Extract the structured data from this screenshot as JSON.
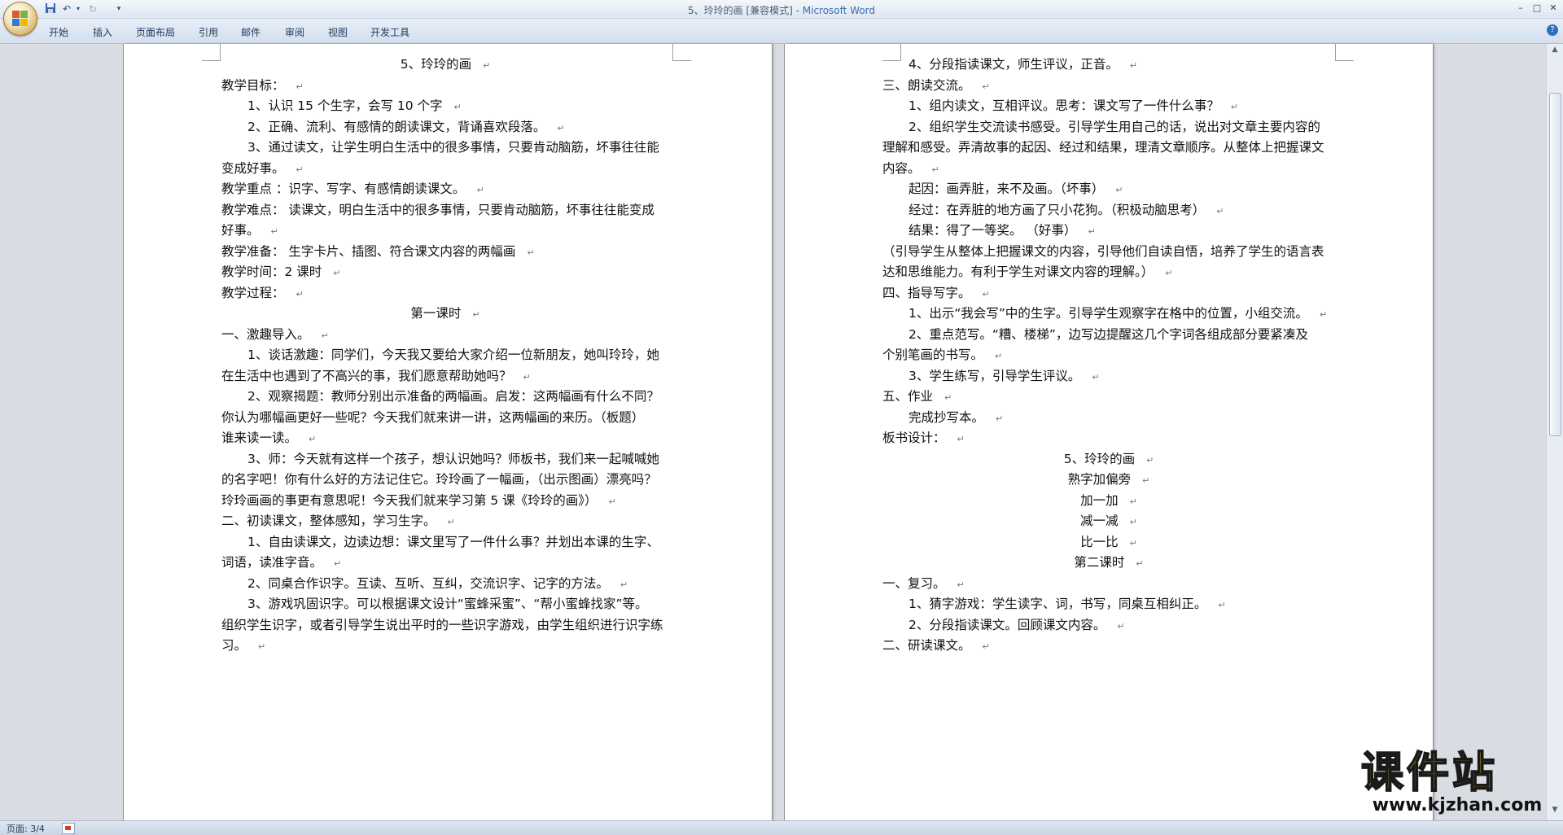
{
  "window": {
    "title_doc": "5、玲玲的画 [兼容模式] - ",
    "title_app": "Microsoft Word"
  },
  "quick_access": {
    "save_icon": "save-icon",
    "undo_icon": "undo-icon",
    "redo_icon": "redo-icon",
    "customize_icon": "dropdown-icon"
  },
  "ribbon": {
    "tabs": [
      "开始",
      "插入",
      "页面布局",
      "引用",
      "邮件",
      "审阅",
      "视图",
      "开发工具"
    ]
  },
  "document": {
    "left_page": [
      {
        "text": "5、玲玲的画",
        "align": "center"
      },
      {
        "text": "教学目标："
      },
      {
        "text": "1、认识 15 个生字，会写 10 个字",
        "indent": true
      },
      {
        "text": "2、正确、流利、有感情的朗读课文，背诵喜欢段落。",
        "indent": true
      },
      {
        "text": "3、通过读文，让学生明白生活中的很多事情，只要肯动脑筋，坏事往往能",
        "indent": true,
        "nomark": true
      },
      {
        "text": "变成好事。"
      },
      {
        "text": "教学重点 ：识字、写字、有感情朗读课文。"
      },
      {
        "text": "教学难点： 读课文，明白生活中的很多事情，只要肯动脑筋，坏事往往能变成",
        "nomark": true
      },
      {
        "text": "好事。"
      },
      {
        "text": "教学准备： 生字卡片、插图、符合课文内容的两幅画"
      },
      {
        "text": "教学时间：2 课时"
      },
      {
        "text": "教学过程："
      },
      {
        "text": "第一课时",
        "align": "center"
      },
      {
        "text": "一、激趣导入。"
      },
      {
        "text": "1、谈话激趣：同学们，今天我又要给大家介绍一位新朋友，她叫玲玲，她",
        "indent": true,
        "nomark": true
      },
      {
        "text": "在生活中也遇到了不高兴的事，我们愿意帮助她吗？"
      },
      {
        "text": "2、观察揭题：教师分别出示准备的两幅画。启发：这两幅画有什么不同？",
        "indent": true,
        "nomark": true
      },
      {
        "text": "你认为哪幅画更好一些呢？今天我们就来讲一讲，这两幅画的来历。（板题）",
        "nomark": true
      },
      {
        "text": "谁来读一读。"
      },
      {
        "text": "3、师：今天就有这样一个孩子，想认识她吗？师板书，我们来一起喊喊她",
        "indent": true,
        "nomark": true
      },
      {
        "text": "的名字吧！你有什么好的方法记住它。玲玲画了一幅画，（出示图画）漂亮吗？",
        "nomark": true
      },
      {
        "text": "玲玲画画的事更有意思呢！今天我们就来学习第 5 课《玲玲的画》）"
      },
      {
        "text": "二、初读课文，整体感知，学习生字。"
      },
      {
        "text": "1、自由读课文，边读边想：课文里写了一件什么事？并划出本课的生字、",
        "indent": true,
        "nomark": true
      },
      {
        "text": "词语，读准字音。"
      },
      {
        "text": "2、同桌合作识字。互读、互听、互纠，交流识字、记字的方法。",
        "indent": true
      },
      {
        "text": "3、游戏巩固识字。可以根据课文设计“蜜蜂采蜜”、“帮小蜜蜂找家”等。",
        "indent": true,
        "nomark": true
      },
      {
        "text": "组织学生识字，或者引导学生说出平时的一些识字游戏，由学生组织进行识字练",
        "nomark": true
      },
      {
        "text": "习。"
      }
    ],
    "right_page": [
      {
        "text": "4、分段指读课文，师生评议，正音。",
        "indent": true
      },
      {
        "text": "三、朗读交流。"
      },
      {
        "text": "1、组内读文，互相评议。思考：课文写了一件什么事？",
        "indent": true
      },
      {
        "text": "2、组织学生交流读书感受。引导学生用自己的话，说出对文章主要内容的",
        "indent": true,
        "nomark": true
      },
      {
        "text": "理解和感受。弄清故事的起因、经过和结果，理清文章顺序。从整体上把握课文",
        "nomark": true
      },
      {
        "text": "内容。"
      },
      {
        "text": "起因：画弄脏，来不及画。（坏事）",
        "indent": true
      },
      {
        "text": "经过：在弄脏的地方画了只小花狗。（积极动脑思考）",
        "indent": true
      },
      {
        "text": "结果：得了一等奖。 （好事）",
        "indent": true
      },
      {
        "text": "（引导学生从整体上把握课文的内容，引导他们自读自悟，培养了学生的语言表",
        "nomark": true
      },
      {
        "text": "达和思维能力。有利于学生对课文内容的理解。）"
      },
      {
        "text": "四、指导写字。"
      },
      {
        "text": "1、出示“我会写”中的生字。引导学生观察字在格中的位置，小组交流。",
        "indent": true
      },
      {
        "text": "2、重点范写。“糟、楼梯”，边写边提醒这几个字词各组成部分要紧凑及",
        "indent": true,
        "nomark": true
      },
      {
        "text": "个别笔画的书写。"
      },
      {
        "text": "3、学生练写，引导学生评议。",
        "indent": true
      },
      {
        "text": "五、作业"
      },
      {
        "text": "完成抄写本。",
        "indent": true
      },
      {
        "text": "板书设计："
      },
      {
        "text": "5、玲玲的画",
        "align": "center"
      },
      {
        "text": "熟字加偏旁",
        "align": "center"
      },
      {
        "text": "加一加",
        "align": "center"
      },
      {
        "text": "减一减",
        "align": "center"
      },
      {
        "text": "比一比",
        "align": "center"
      },
      {
        "text": "第二课时",
        "align": "center"
      },
      {
        "text": " 一、复习。"
      },
      {
        "text": "1、猜字游戏：学生读字、词，书写，同桌互相纠正。",
        "indent": true
      },
      {
        "text": "2、分段指读课文。回顾课文内容。",
        "indent": true
      },
      {
        "text": "二、研读课文。"
      }
    ],
    "paragraph_mark": "↵"
  },
  "status_bar": {
    "page_info": "页面: 3/4"
  },
  "watermark": {
    "title": "课件站",
    "url": "www.kjzhan.com"
  }
}
